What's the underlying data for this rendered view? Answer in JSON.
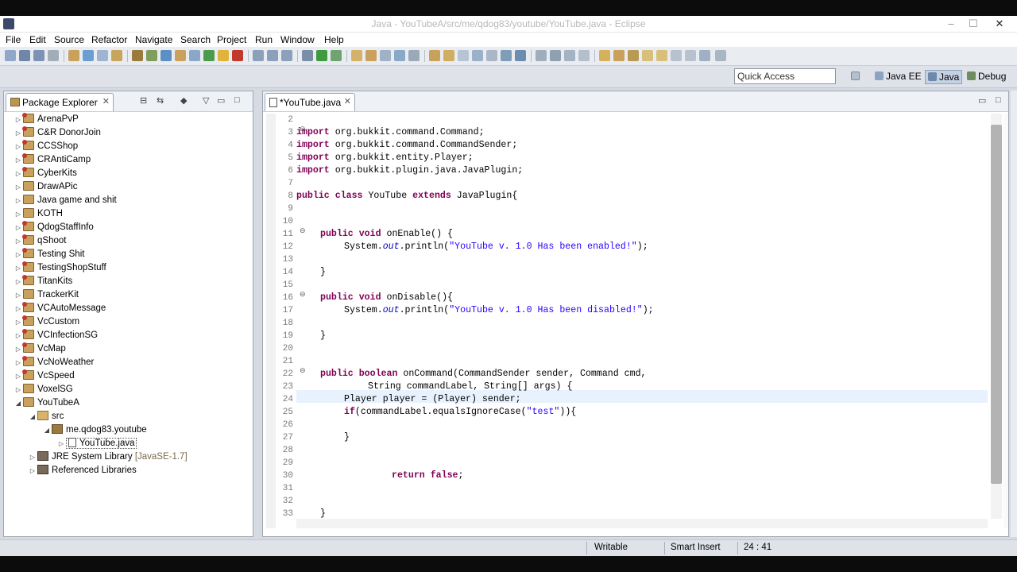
{
  "window": {
    "title": "Java - YouTubeA/src/me/qdog83/youtube/YouTube.java - Eclipse",
    "minimize": "–",
    "maximize": "☐",
    "close": "✕"
  },
  "menu": [
    "File",
    "Edit",
    "Source",
    "Refactor",
    "Navigate",
    "Search",
    "Project",
    "Run",
    "Window",
    "Help"
  ],
  "quick_access": {
    "placeholder": "Quick Access"
  },
  "perspectives": [
    {
      "label": "Java EE",
      "active": false
    },
    {
      "label": "Java",
      "active": true
    },
    {
      "label": "Debug",
      "active": false
    }
  ],
  "package_explorer": {
    "tab_label": "Package Explorer",
    "close": "✕",
    "projects": [
      "ArenaPvP",
      "C&R DonorJoin",
      "CCSShop",
      "CRAntiCamp",
      "CyberKits",
      "DrawAPic",
      "Java game and shit",
      "KOTH",
      "QdogStaffInfo",
      "qShoot",
      "Testing Shit",
      "TestingShopStuff",
      "TitanKits",
      "TrackerKit",
      "VCAutoMessage",
      "VcCustom",
      "VCInfectionSG",
      "VcMap",
      "VcNoWeather",
      "VcSpeed",
      "VoxelSG"
    ],
    "open_project": "YouTubeA",
    "src_folder": "src",
    "package_name": "me.qdog83.youtube",
    "file_name": "YouTube.java",
    "jre": "JRE System Library",
    "jre_version": "[JavaSE-1.7]",
    "referenced": "Referenced Libraries"
  },
  "editor": {
    "tab_label": "*YouTube.java",
    "close": "✕",
    "line_numbers": [
      "2",
      "3",
      "4",
      "5",
      "6",
      "7",
      "8",
      "9",
      "10",
      "11",
      "12",
      "13",
      "14",
      "15",
      "16",
      "17",
      "18",
      "19",
      "20",
      "21",
      "22",
      "23",
      "24",
      "25",
      "26",
      "27",
      "28",
      "29",
      "30",
      "31",
      "32",
      "33"
    ],
    "code": {
      "l3_kw": "import",
      "l3": " org.bukkit.command.Command;",
      "l4_kw": "import",
      "l4": " org.bukkit.command.CommandSender;",
      "l5_kw": "import",
      "l5": " org.bukkit.entity.Player;",
      "l6_kw": "import",
      "l6": " org.bukkit.plugin.java.JavaPlugin;",
      "l8_kw1": "public",
      "l8_kw2": "class",
      "l8_name": " YouTube ",
      "l8_kw3": "extends",
      "l8_rest": " JavaPlugin{",
      "l11_kw1": "public",
      "l11_kw2": "void",
      "l11_rest": " onEnable() {",
      "l12_pre": "System.",
      "l12_out": "out",
      "l12_mid": ".println(",
      "l12_str": "\"YouTube v. 1.0 Has been enabled!\"",
      "l12_end": ");",
      "l14": "}",
      "l16_kw1": "public",
      "l16_kw2": "void",
      "l16_rest": " onDisable(){",
      "l17_pre": "System.",
      "l17_out": "out",
      "l17_mid": ".println(",
      "l17_str": "\"YouTube v. 1.0 Has been disabled!\"",
      "l17_end": ");",
      "l19": "}",
      "l22_kw1": "public",
      "l22_kw2": "boolean",
      "l22_rest": " onCommand(CommandSender sender, Command cmd,",
      "l23": "String commandLabel, String[] args) {",
      "l24": "Player player = (Player) sender;",
      "l25_kw": "if",
      "l25_pre": "(commandLabel.equalsIgnoreCase(",
      "l25_str": "\"test\"",
      "l25_end": ")){",
      "l27": "}",
      "l30_kw": "return",
      "l30_sp": " ",
      "l30_kw2": "false",
      "l30_end": ";",
      "l33": "}"
    }
  },
  "status_bar": {
    "writable": "Writable",
    "insert_mode": "Smart Insert",
    "position": "24 : 41"
  }
}
